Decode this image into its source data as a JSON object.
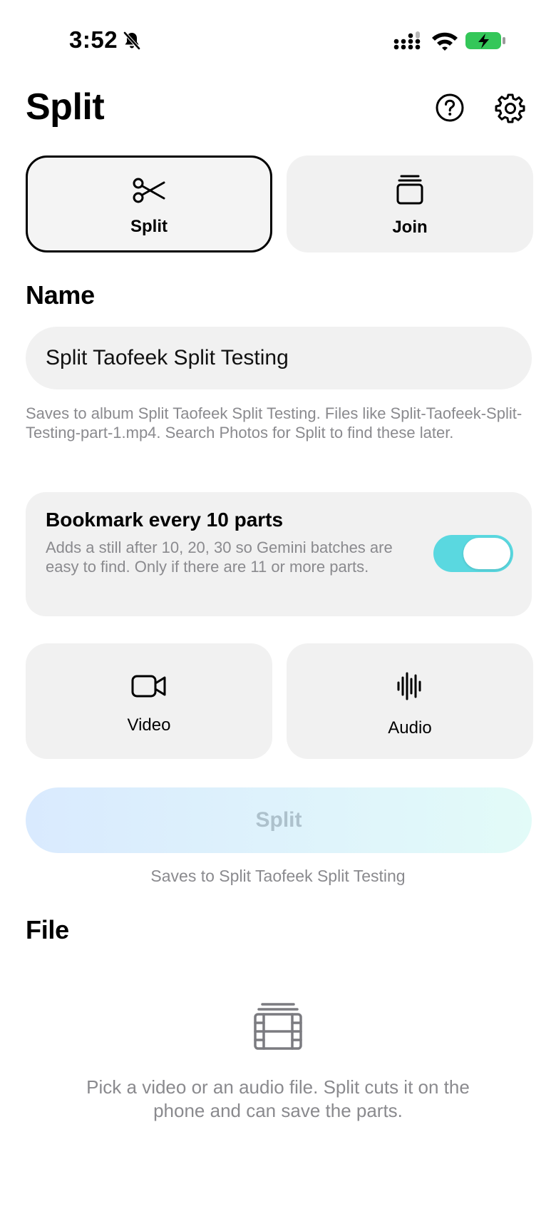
{
  "status_bar": {
    "time": "3:52"
  },
  "header": {
    "title": "Split",
    "help_icon": "question-circle-icon",
    "settings_icon": "gear-icon"
  },
  "modes": [
    {
      "label": "Split",
      "icon": "scissors-icon",
      "selected": true
    },
    {
      "label": "Join",
      "icon": "stack-icon",
      "selected": false
    }
  ],
  "name_section": {
    "title": "Name",
    "value": "Split Taofeek Split Testing",
    "helper": "Saves to album Split Taofeek Split Testing. Files like Split-Taofeek-Split-Testing-part-1.mp4. Search Photos for Split to find these later."
  },
  "bookmark": {
    "title": "Bookmark every 10 parts",
    "description": "Adds a still after 10, 20, 30 so Gemini batches are easy to find. Only if there are 11 or more parts.",
    "enabled": true,
    "toggle_color": "#5ad8e0"
  },
  "media_types": [
    {
      "label": "Video",
      "icon": "video-camera-icon"
    },
    {
      "label": "Audio",
      "icon": "waveform-icon"
    }
  ],
  "action": {
    "label": "Split",
    "note": "Saves to Split Taofeek Split Testing"
  },
  "file_section": {
    "title": "File",
    "icon": "film-stack-icon",
    "empty_text": "Pick a video or an audio file. Split cuts it on the phone and can save the parts."
  }
}
